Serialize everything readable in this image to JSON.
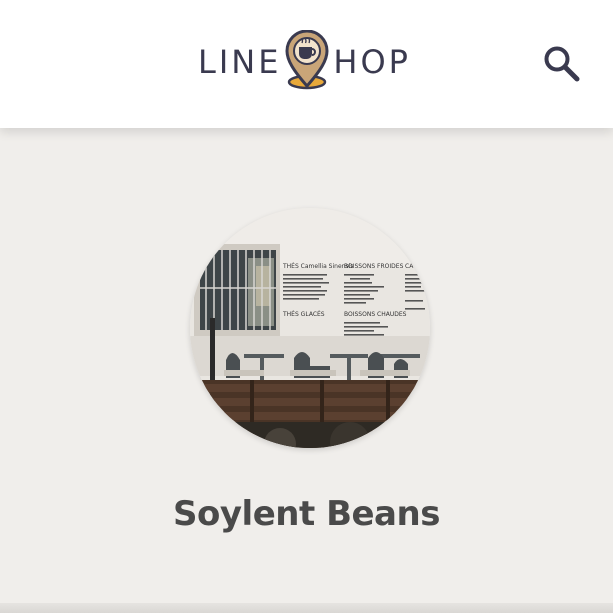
{
  "header": {
    "logo_left": "LINE",
    "logo_right": "HOP",
    "search_icon": "search-icon",
    "logo_icon": "coffee-location-pin-icon"
  },
  "shop": {
    "name": "Soylent Beans",
    "menu_headings": [
      "THÉS Camellia Sinensis",
      "BOISSONS FROIDES",
      "CA",
      "THÉS GLACÉS",
      "BOISSONS CHAUDES"
    ]
  },
  "colors": {
    "header_bg": "#ffffff",
    "page_bg": "#f0eeeb",
    "logo_text": "#3a3a4f",
    "pin_fill": "#c9a578",
    "pin_base": "#e8a93a",
    "name_text": "#4a4a4a"
  }
}
